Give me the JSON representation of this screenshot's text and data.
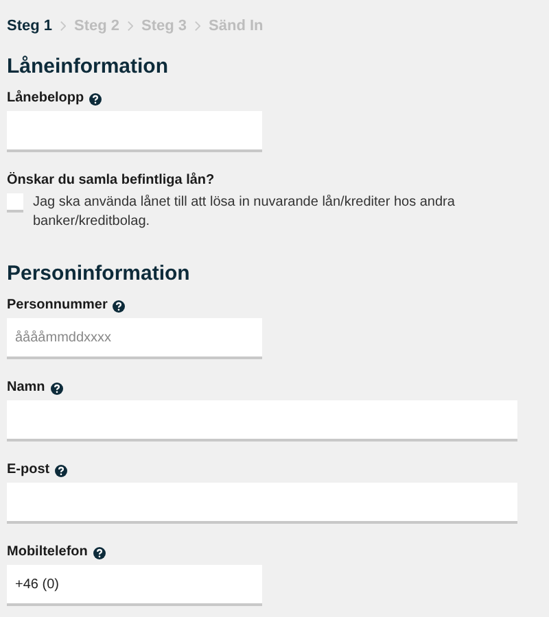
{
  "steps": [
    {
      "label": "Steg 1",
      "selected": true
    },
    {
      "label": "Steg 2",
      "selected": false
    },
    {
      "label": "Steg 3",
      "selected": false
    },
    {
      "label": "Sänd In",
      "selected": false
    }
  ],
  "sections": [
    {
      "title": "Låneinformation",
      "items": [
        {
          "kind": "short_field",
          "label": "Lånebelopp",
          "help": true
        },
        {
          "kind": "checkbox",
          "label": "Önskar du samla befintliga lån?",
          "text": "Jag ska använda lånet till att lösa in nuvarande lån/krediter hos andra banker/kreditbolag.",
          "checked": false
        }
      ]
    },
    {
      "title": "Personinformation",
      "items": [
        {
          "kind": "short_field",
          "label": "Personnummer",
          "help": true,
          "placeholder": "ååååmmddxxxx"
        },
        {
          "kind": "long_field",
          "label": "Namn",
          "help": true
        },
        {
          "kind": "long_field",
          "label": "E-post",
          "help": true
        },
        {
          "kind": "short_field",
          "label": "Mobiltelefon",
          "help": true,
          "value": "+46 (0)"
        }
      ]
    }
  ]
}
